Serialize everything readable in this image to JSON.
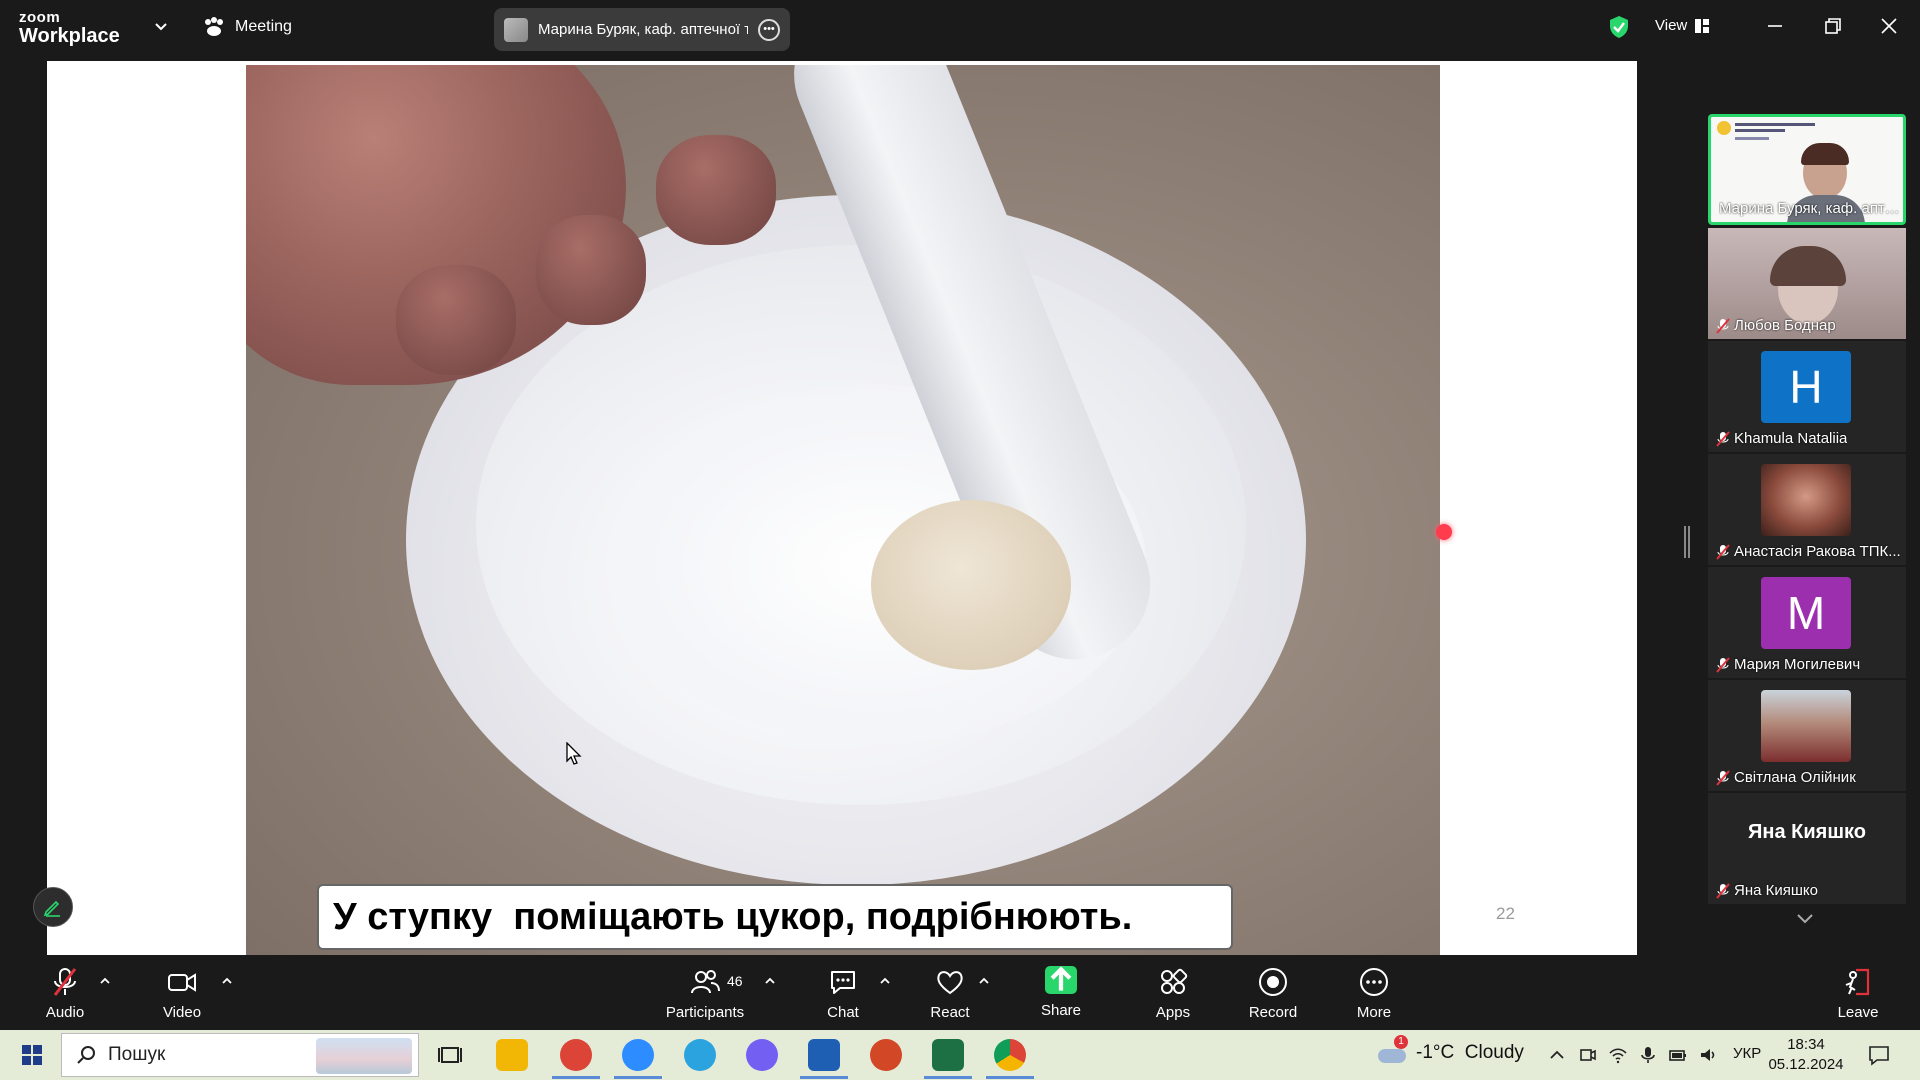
{
  "window": {
    "brand_top": "zoom",
    "brand_bottom": "Workplace",
    "meeting_label": "Meeting",
    "active_speaker": "Марина Буряк, каф. аптечної те",
    "view_label": "View"
  },
  "presentation": {
    "caption": "У ступку  поміщають цукор, подрібнюють.",
    "slide_number": "22"
  },
  "participants": [
    {
      "name": "Марина Буряк, каф. апте...",
      "kind": "video-slide",
      "muted": false,
      "active": true
    },
    {
      "name": "Любов Боднар",
      "kind": "video",
      "muted": true
    },
    {
      "name": "Khamula Nataliia",
      "kind": "avatar",
      "letter": "H",
      "color": "#0e72c7",
      "muted": true
    },
    {
      "name": "Анастасія Ракова ТПК...",
      "kind": "photo",
      "muted": true
    },
    {
      "name": "Мария Могилевич",
      "kind": "avatar",
      "letter": "M",
      "color": "#9b2fae",
      "muted": true
    },
    {
      "name": "Світлана Олійник",
      "kind": "photo",
      "muted": true
    },
    {
      "name": "Яна Кияшко",
      "kind": "name-only",
      "display": "Яна Кияшко",
      "muted": true
    }
  ],
  "toolbar": {
    "audio": "Audio",
    "video": "Video",
    "participants": "Participants",
    "participants_count": "46",
    "chat": "Chat",
    "react": "React",
    "share": "Share",
    "apps": "Apps",
    "record": "Record",
    "more": "More",
    "leave": "Leave"
  },
  "taskbar": {
    "search_placeholder": "Пошук",
    "weather": "-1°C  Cloudy",
    "weather_badge": "1",
    "language": "УКР",
    "time": "18:34",
    "date": "05.12.2024",
    "apps": [
      {
        "name": "task-view",
        "color": "#e4ecd8"
      },
      {
        "name": "file-explorer",
        "color": "#f2b705"
      },
      {
        "name": "chrome-profile",
        "color": "#db4437"
      },
      {
        "name": "zoom",
        "color": "#2d8cff"
      },
      {
        "name": "telegram",
        "color": "#2aa3df"
      },
      {
        "name": "viber",
        "color": "#7360f2"
      },
      {
        "name": "word",
        "color": "#1f5fb3"
      },
      {
        "name": "powerpoint",
        "color": "#d24726"
      },
      {
        "name": "excel",
        "color": "#1d7044"
      },
      {
        "name": "chrome",
        "color": "#4285f4"
      }
    ]
  },
  "colors": {
    "accent_green": "#29d66b",
    "mute_red": "#e0323b",
    "laser": "#ff3b4e"
  }
}
